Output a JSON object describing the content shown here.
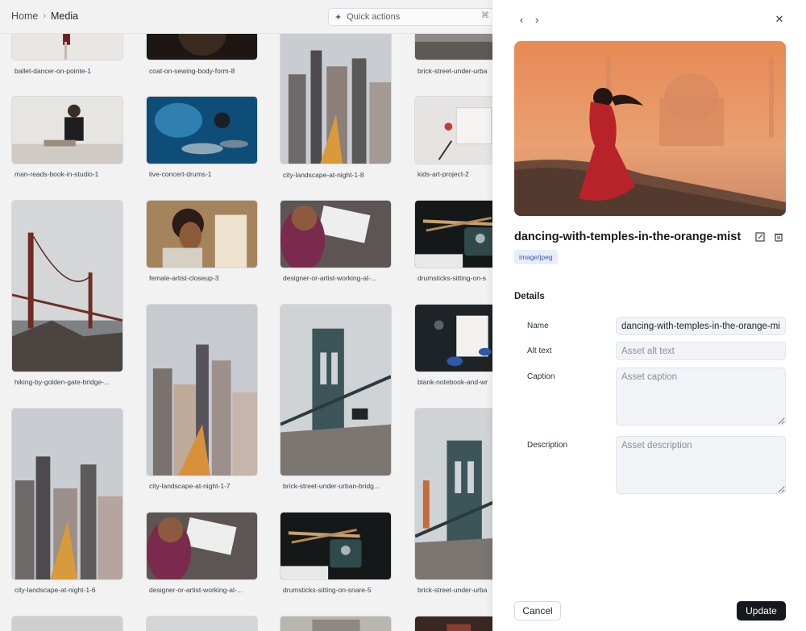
{
  "breadcrumb": {
    "home": "Home",
    "current": "Media"
  },
  "quick_actions": {
    "label": "Quick actions",
    "shortcut": "⌘"
  },
  "grid_items": [
    {
      "caption": "ballet-dancer-on-pointe-1"
    },
    {
      "caption": "coat-on-sewing-body-form-8"
    },
    {
      "caption": "city-landscape-at-night-1-8"
    },
    {
      "caption": "brick-street-under-urba"
    },
    {
      "caption": "man-reads-book-in-studio-1"
    },
    {
      "caption": "live-concert-drums-1"
    },
    {
      "caption": "kids-art-project-2"
    },
    {
      "caption": "hiking-by-golden-gate-bridge-..."
    },
    {
      "caption": "female-artist-closeup-3"
    },
    {
      "caption": "designer-or-artist-working-at-..."
    },
    {
      "caption": "drumsticks-sitting-on-s"
    },
    {
      "caption": "city-landscape-at-night-1-7"
    },
    {
      "caption": "brick-street-under-urban-bridg..."
    },
    {
      "caption": "blank-notebook-and-wr"
    },
    {
      "caption": "city-landscape-at-night-1-6"
    },
    {
      "caption": "designer-or-artist-working-at-..."
    },
    {
      "caption": "drumsticks-sitting-on-snare-5"
    },
    {
      "caption": "brick-street-under-urba"
    }
  ],
  "drawer": {
    "title": "dancing-with-temples-in-the-orange-mist",
    "mime": "image/jpeg",
    "details_heading": "Details",
    "fields": {
      "name": {
        "label": "Name",
        "value": "dancing-with-temples-in-the-orange-mist"
      },
      "alt": {
        "label": "Alt text",
        "placeholder": "Asset alt text"
      },
      "caption": {
        "label": "Caption",
        "placeholder": "Asset caption"
      },
      "description": {
        "label": "Description",
        "placeholder": "Asset description"
      }
    },
    "cancel_label": "Cancel",
    "update_label": "Update"
  },
  "colors": {
    "accent": "#15181d",
    "badge_bg": "#e8edf9",
    "badge_text": "#3a57c4"
  },
  "icons": [
    "chevron-left-icon",
    "chevron-right-icon",
    "close-icon",
    "sparkle-icon",
    "command-icon",
    "open-asset-icon",
    "trash-icon"
  ]
}
